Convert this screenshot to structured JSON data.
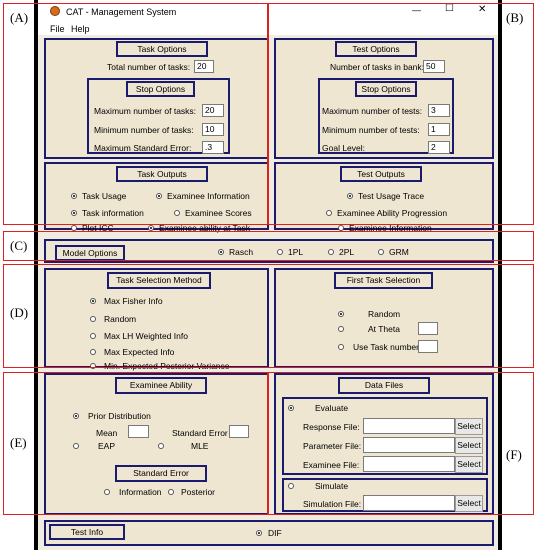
{
  "window": {
    "title": "CAT - Management System",
    "minimize": "—",
    "maximize": "☐",
    "close": "✕"
  },
  "menu": [
    "File",
    "Help"
  ],
  "side_labels": {
    "a": "(A)",
    "b": "(B)",
    "c": "(C)",
    "d": "(D)",
    "e": "(E)",
    "f": "(F)"
  },
  "task_options": {
    "title": "Task Options",
    "total_label": "Total number of tasks:",
    "total_value": "20",
    "stop_title": "Stop Options",
    "max_label": "Maximum number of tasks:",
    "max_value": "20",
    "min_label": "Minimum number of tasks:",
    "min_value": "10",
    "se_label": "Maximum Standard Error:",
    "se_value": ".3"
  },
  "test_options": {
    "title": "Test Options",
    "bank_label": "Number of tasks in bank:",
    "bank_value": "50",
    "stop_title": "Stop Options",
    "max_label": "Maximum number of tests:",
    "max_value": "3",
    "min_label": "Minimum number of tests:",
    "min_value": "1",
    "goal_label": "Goal Level:",
    "goal_value": "2"
  },
  "task_outputs": {
    "title": "Task Outputs",
    "items": [
      "Task Usage",
      "Examinee Information",
      "Task information",
      "Examinee Scores",
      "Plot ICC",
      "Examinee ability at Task"
    ]
  },
  "test_outputs": {
    "title": "Test Outputs",
    "items": [
      "Test Usage Trace",
      "Examinee Ability Progression",
      "Examinee Information"
    ]
  },
  "model_options": {
    "title": "Model Options",
    "items": [
      "Rasch",
      "1PL",
      "2PL",
      "GRM"
    ]
  },
  "task_selection": {
    "title": "Task Selection Method",
    "items": [
      "Max Fisher Info",
      "Random",
      "Max LH Weighted Info",
      "Max Expected Info",
      "Min. Expected Posterior Variance"
    ]
  },
  "first_task": {
    "title": "First Task Selection",
    "items": [
      "Random",
      "At Theta",
      "Use Task number"
    ]
  },
  "examinee_ability": {
    "title": "Examinee Ability",
    "prior": "Prior Distribution",
    "mean": "Mean",
    "sd": "Standard Error",
    "eap": "EAP",
    "mle": "MLE",
    "se_title": "Standard Error",
    "information": "Information",
    "posterior": "Posterior"
  },
  "data_files": {
    "title": "Data Files",
    "evaluate": "Evaluate",
    "response": "Response File:",
    "parameter": "Parameter File:",
    "examinee": "Examinee File:",
    "simulate": "Simulate",
    "simulation": "Simulation File:",
    "select": "Select"
  },
  "test_info": {
    "title": "Test Info",
    "dif": "DIF"
  }
}
